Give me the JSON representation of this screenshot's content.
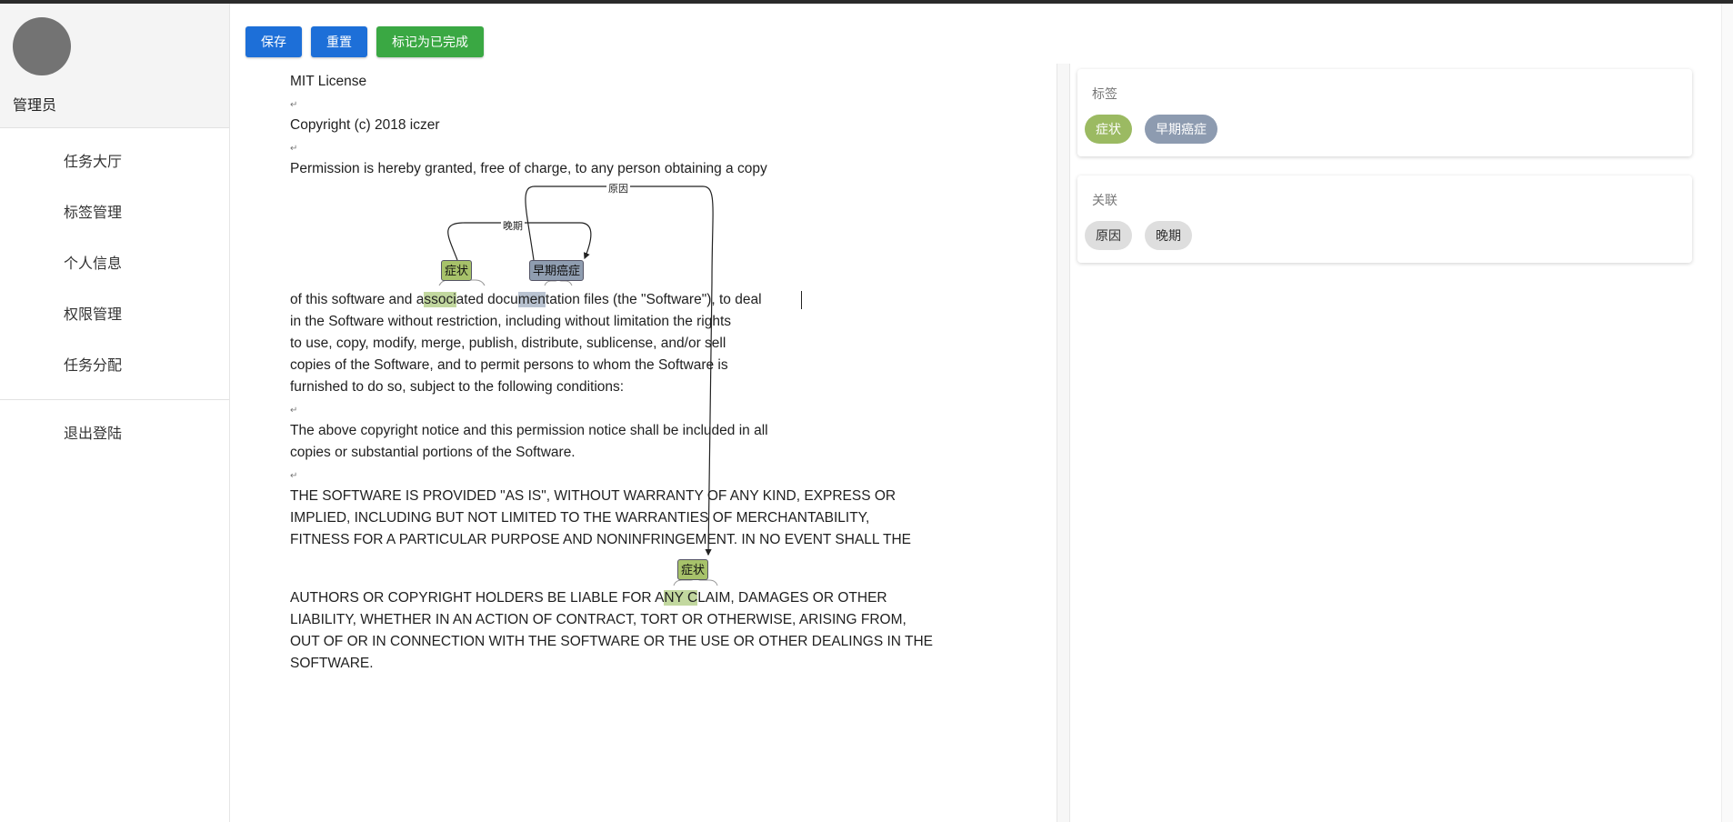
{
  "user": {
    "name": "管理员"
  },
  "nav": {
    "items": [
      "任务大厅",
      "标签管理",
      "个人信息",
      "权限管理",
      "任务分配"
    ],
    "logout": "退出登陆"
  },
  "toolbar": {
    "save": "保存",
    "reset": "重置",
    "complete": "标记为已完成"
  },
  "document": {
    "lines": [
      "MIT License",
      "Copyright (c) 2018 iczer",
      "Permission is hereby granted, free of charge, to any person obtaining a copy",
      "in the Software without restriction, including without limitation the rights",
      "to use, copy, modify, merge, publish, distribute, sublicense, and/or sell",
      "copies of the Software, and to permit persons to whom the Software is",
      "furnished to do so, subject to the following conditions:",
      "The above copyright notice and this permission notice shall be included in all",
      "copies or substantial portions of the Software.",
      "THE SOFTWARE IS PROVIDED \"AS IS\", WITHOUT WARRANTY OF ANY KIND, EXPRESS OR",
      "IMPLIED, INCLUDING BUT NOT LIMITED TO THE WARRANTIES OF MERCHANTABILITY,",
      "FITNESS FOR A PARTICULAR PURPOSE AND NONINFRINGEMENT. IN NO EVENT SHALL THE",
      "LIABILITY, WHETHER IN AN ACTION OF CONTRACT, TORT OR OTHERWISE, ARISING FROM,",
      "OUT OF OR IN CONNECTION WITH THE SOFTWARE OR THE USE OR OTHER DEALINGS IN THE",
      "SOFTWARE."
    ],
    "line_deal": {
      "a": "of this software and a",
      "b": "ssoci",
      "c": "ated docu",
      "d": "men",
      "e": "tation files (the \"Software\"), to deal"
    },
    "line_authors": {
      "a": "AUTHORS OR COPYRIGHT HOLDERS BE LIABLE FOR A",
      "b": "NY C",
      "c": "LAIM, DAMAGES OR OTHER"
    },
    "annotations": [
      "症状",
      "早期癌症",
      "症状"
    ],
    "relations": [
      "晚期",
      "原因"
    ],
    "cr_mark": "↵"
  },
  "panels": {
    "labels": {
      "title": "标签",
      "chips": [
        "症状",
        "早期癌症"
      ]
    },
    "relations": {
      "title": "关联",
      "chips": [
        "原因",
        "晚期"
      ]
    }
  },
  "colors": {
    "symptom": "#9bba62",
    "early_cancer": "#8d9bb0",
    "primary": "#1d6fd8",
    "success": "#3aa843"
  }
}
